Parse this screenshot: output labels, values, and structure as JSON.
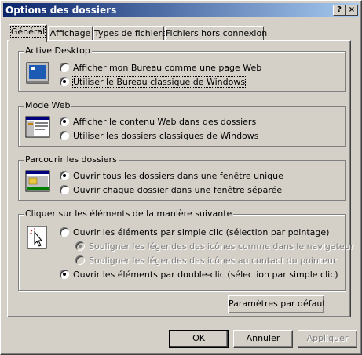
{
  "window": {
    "title": "Options des dossiers",
    "help_button": "?",
    "close_button": "×"
  },
  "tabs": [
    {
      "label": "Général",
      "active": true
    },
    {
      "label": "Affichage",
      "active": false
    },
    {
      "label": "Types de fichiers",
      "active": false
    },
    {
      "label": "Fichiers hors connexion",
      "active": false
    }
  ],
  "groups": {
    "active_desktop": {
      "legend": "Active Desktop",
      "icon": "desktop-monitor-icon",
      "options": [
        {
          "label": "Afficher mon Bureau comme une page Web",
          "selected": false
        },
        {
          "label": "Utiliser le Bureau classique de Windows",
          "selected": true
        }
      ]
    },
    "mode_web": {
      "legend": "Mode Web",
      "icon": "web-window-icon",
      "options": [
        {
          "label": "Afficher le contenu Web dans des dossiers",
          "selected": true
        },
        {
          "label": "Utiliser les dossiers classiques de Windows",
          "selected": false
        }
      ]
    },
    "parcourir": {
      "legend": "Parcourir les dossiers",
      "icon": "folder-window-icon",
      "options": [
        {
          "label": "Ouvrir tous les dossiers dans une fenêtre unique",
          "selected": true
        },
        {
          "label": "Ouvrir chaque dossier dans une fenêtre séparée",
          "selected": false
        }
      ]
    },
    "cliquer": {
      "legend": "Cliquer sur les éléments de la manière suivante",
      "icon": "pointer-click-icon",
      "options": [
        {
          "label": "Ouvrir les éléments par simple clic (sélection par pointage)",
          "selected": false
        },
        {
          "label": "Souligner les légendes des icônes comme dans le navigateur",
          "selected": true,
          "disabled": true
        },
        {
          "label": "Souligner les légendes des icônes au contact du pointeur",
          "selected": false,
          "disabled": true
        },
        {
          "label": "Ouvrir les éléments par double-clic (sélection par simple clic)",
          "selected": true
        }
      ]
    }
  },
  "buttons": {
    "defaults": "Paramètres par défaut",
    "ok": "OK",
    "cancel": "Annuler",
    "apply": "Appliquer"
  },
  "colors": {
    "face": "#d4d0c8",
    "title_start": "#0a246a",
    "title_end": "#a6caf0"
  }
}
